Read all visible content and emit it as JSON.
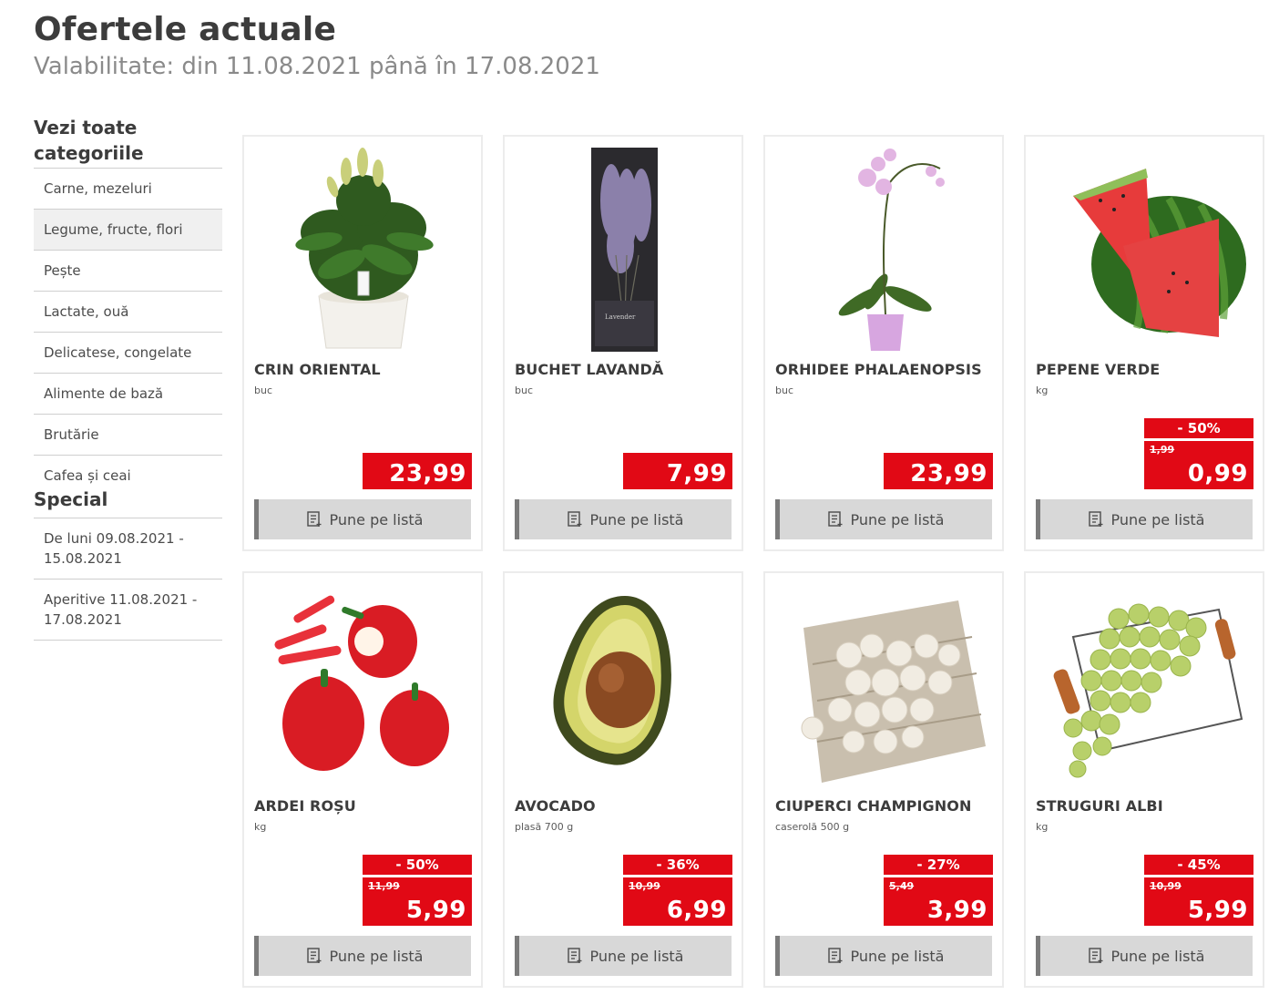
{
  "header": {
    "title": "Ofertele actuale",
    "validity": "Valabilitate: din 11.08.2021 până în 17.08.2021"
  },
  "sidebar": {
    "categories_heading": "Vezi toate categoriile",
    "categories": [
      {
        "label": "Carne, mezeluri"
      },
      {
        "label": "Legume, fructe, flori"
      },
      {
        "label": "Pește"
      },
      {
        "label": "Lactate, ouă"
      },
      {
        "label": "Delicatese, congelate"
      },
      {
        "label": "Alimente de bază"
      },
      {
        "label": "Brutărie"
      },
      {
        "label": "Cafea și ceai"
      }
    ],
    "special_heading": "Special",
    "special": [
      {
        "label": "De luni 09.08.2021 - 15.08.2021"
      },
      {
        "label": "Aperitive 11.08.2021 - 17.08.2021"
      }
    ]
  },
  "button_label": "Pune pe listă",
  "products": [
    {
      "name": "CRIN ORIENTAL",
      "unit": "buc",
      "price": "23,99",
      "old_price": "",
      "discount": ""
    },
    {
      "name": "BUCHET LAVANDĂ",
      "unit": "buc",
      "price": "7,99",
      "old_price": "",
      "discount": ""
    },
    {
      "name": "ORHIDEE PHALAENOPSIS",
      "unit": "buc",
      "price": "23,99",
      "old_price": "",
      "discount": ""
    },
    {
      "name": "PEPENE VERDE",
      "unit": "kg",
      "price": "0,99",
      "old_price": "1,99",
      "discount": "- 50%"
    },
    {
      "name": "ARDEI ROȘU",
      "unit": "kg",
      "price": "5,99",
      "old_price": "11,99",
      "discount": "- 50%"
    },
    {
      "name": "AVOCADO",
      "unit": "plasă 700 g",
      "price": "6,99",
      "old_price": "10,99",
      "discount": "- 36%"
    },
    {
      "name": "CIUPERCI CHAMPIGNON",
      "unit": "caserolă 500 g",
      "price": "3,99",
      "old_price": "5,49",
      "discount": "- 27%"
    },
    {
      "name": "STRUGURI ALBI",
      "unit": "kg",
      "price": "5,99",
      "old_price": "10,99",
      "discount": "- 45%"
    }
  ],
  "colors": {
    "accent_red": "#e10915",
    "button_grey": "#d8d8d8"
  }
}
